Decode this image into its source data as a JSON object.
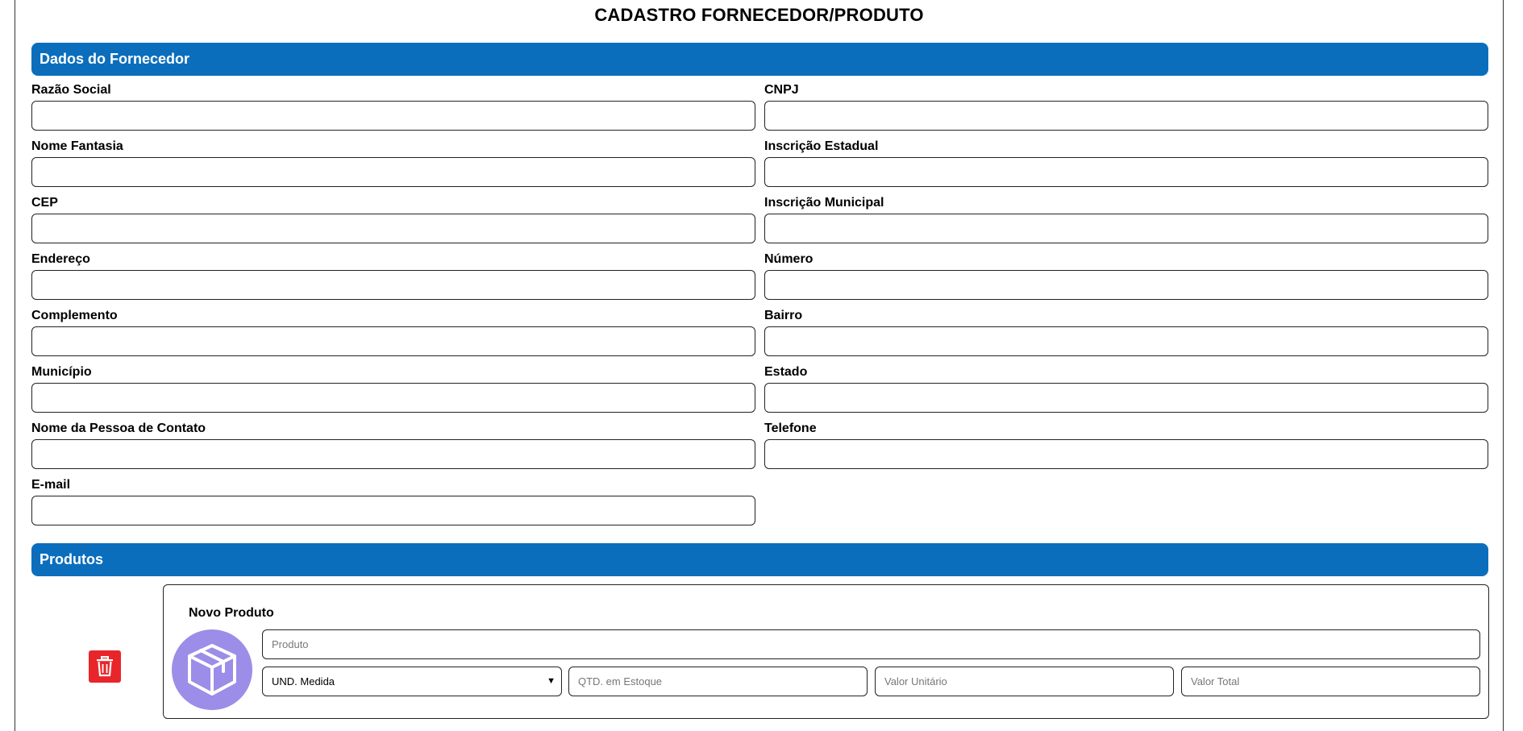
{
  "title": "CADASTRO FORNECEDOR/PRODUTO",
  "colors": {
    "section_bar": "#0a6ebd",
    "avatar": "#9b8de8",
    "delete_button": "#e8262a"
  },
  "supplier": {
    "section_title": "Dados do Fornecedor",
    "fields": {
      "razao_social": "Razão Social",
      "cnpj": "CNPJ",
      "nome_fantasia": "Nome Fantasia",
      "inscricao_estadual": "Inscrição Estadual",
      "cep": "CEP",
      "inscricao_municipal": "Inscrição Municipal",
      "endereco": "Endereço",
      "numero": "Número",
      "complemento": "Complemento",
      "bairro": "Bairro",
      "municipio": "Município",
      "estado": "Estado",
      "contato": "Nome da Pessoa de Contato",
      "telefone": "Telefone",
      "email": "E-mail"
    }
  },
  "products": {
    "section_title": "Produtos",
    "card": {
      "heading": "Novo Produto",
      "produto_placeholder": "Produto",
      "unidade_selected": "UND. Medida",
      "qtd_placeholder": "QTD. em Estoque",
      "valor_unitario_placeholder": "Valor Unitário",
      "valor_total_placeholder": "Valor Total"
    },
    "icons": {
      "product": "box-icon",
      "delete": "trash-icon"
    }
  }
}
